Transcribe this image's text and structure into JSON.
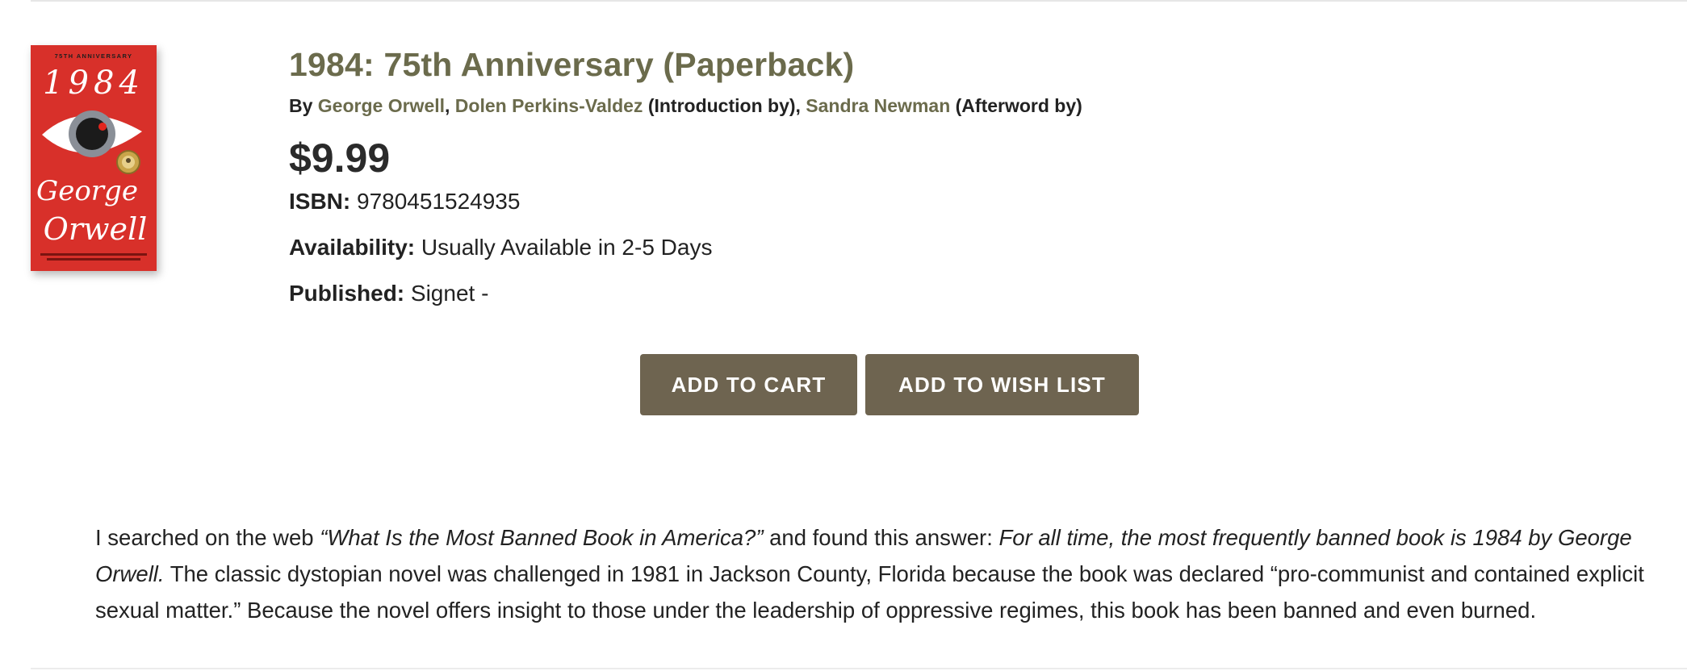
{
  "colors": {
    "accent_green": "#6b6b4c",
    "button_bg": "#6e6450",
    "cover_red": "#d8302a"
  },
  "cover": {
    "top_text": "75TH ANNIVERSARY",
    "title_text": "1984",
    "author_line1": "George",
    "author_line2": "Orwell"
  },
  "product": {
    "title": "1984: 75th Anniversary (Paperback)",
    "by_prefix": "By",
    "authors": [
      {
        "name": "George Orwell",
        "role": ""
      },
      {
        "name": "Dolen Perkins-Valdez",
        "role": " (Introduction by)"
      },
      {
        "name": "Sandra Newman",
        "role": " (Afterword by)"
      }
    ],
    "sep": ", ",
    "price": "$9.99",
    "isbn_label": "ISBN:",
    "isbn_value": " 9780451524935",
    "availability_label": "Availability:",
    "availability_value": " Usually Available in 2-5 Days",
    "published_label": "Published:",
    "published_value": " Signet -"
  },
  "actions": {
    "add_to_cart": "ADD TO CART",
    "add_to_wish_list": "ADD TO WISH LIST"
  },
  "description": {
    "part1": "I searched on the web ",
    "query": "“What Is the Most Banned Book in America?”",
    "part2": " and found this answer: ",
    "answer": "For all time, the most frequently banned book is 1984 by George Orwell.",
    "part3": " The classic dystopian novel was challenged in 1981 in Jackson County, Florida because the book was declared “pro-communist and contained explicit sexual matter.” Because the novel offers insight to those under the leadership of oppressive regimes, this book has been banned and even burned."
  }
}
